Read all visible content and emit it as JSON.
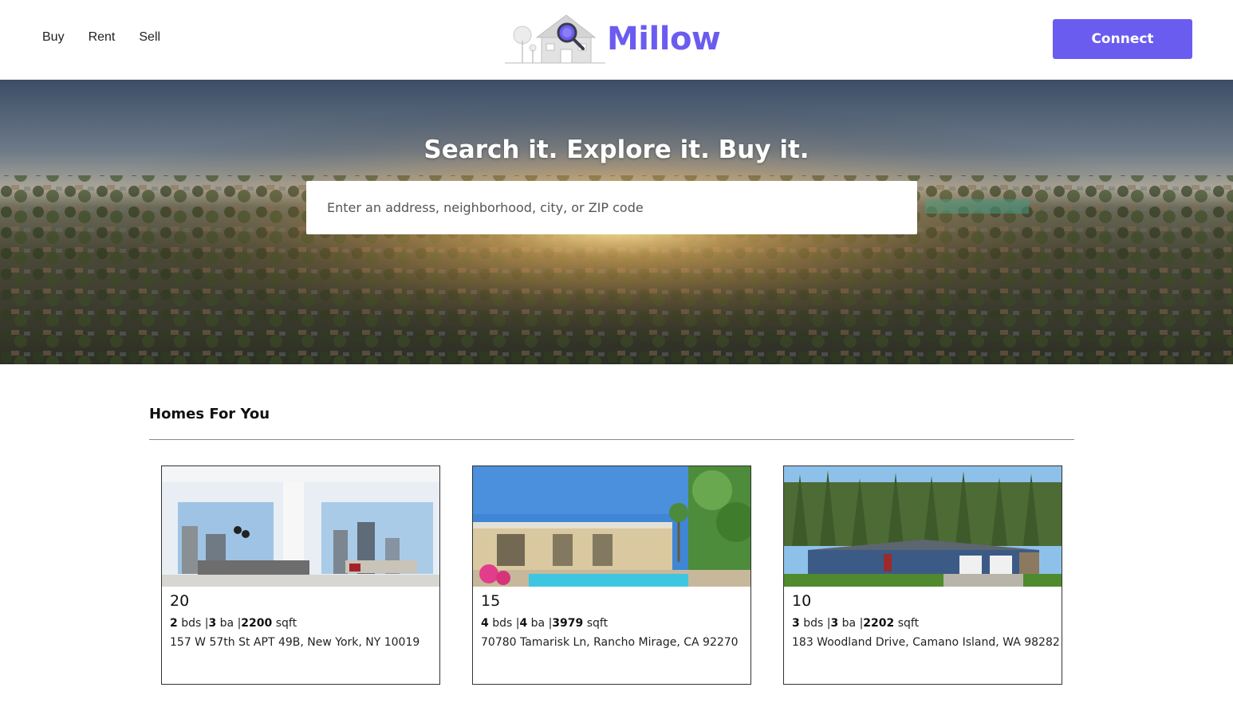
{
  "nav": {
    "links": [
      "Buy",
      "Rent",
      "Sell"
    ],
    "connect_label": "Connect"
  },
  "brand": {
    "name": "Millow",
    "accent_color": "#6b5cf0"
  },
  "hero": {
    "title": "Search it. Explore it. Buy it.",
    "search_placeholder": "Enter an address, neighborhood, city, or ZIP code"
  },
  "homes": {
    "section_title": "Homes For You",
    "listings": [
      {
        "price": "20",
        "beds": "2",
        "beds_label": "bds",
        "baths": "3",
        "baths_label": "ba",
        "sqft": "2200",
        "sqft_label": "sqft",
        "address": "157 W 57th St APT 49B, New York, NY 10019"
      },
      {
        "price": "15",
        "beds": "4",
        "beds_label": "bds",
        "baths": "4",
        "baths_label": "ba",
        "sqft": "3979",
        "sqft_label": "sqft",
        "address": "70780 Tamarisk Ln, Rancho Mirage, CA 92270"
      },
      {
        "price": "10",
        "beds": "3",
        "beds_label": "bds",
        "baths": "3",
        "baths_label": "ba",
        "sqft": "2202",
        "sqft_label": "sqft",
        "address": "183 Woodland Drive, Camano Island, WA 98282"
      }
    ]
  }
}
